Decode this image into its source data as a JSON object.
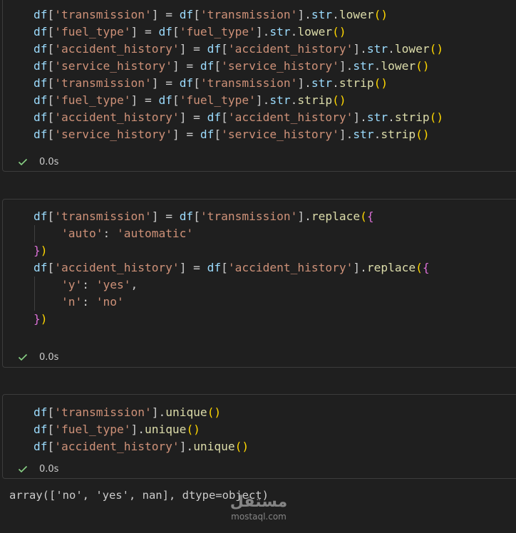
{
  "cells": [
    {
      "lines": [
        [
          [
            "v",
            "df"
          ],
          [
            "p",
            "["
          ],
          [
            "s",
            "'transmission'"
          ],
          [
            "p",
            "] = "
          ],
          [
            "v",
            "df"
          ],
          [
            "p",
            "["
          ],
          [
            "s",
            "'transmission'"
          ],
          [
            "p",
            "]."
          ],
          [
            "v",
            "str"
          ],
          [
            "p",
            "."
          ],
          [
            "f",
            "lower"
          ],
          [
            "b1",
            "()"
          ]
        ],
        [
          [
            "v",
            "df"
          ],
          [
            "p",
            "["
          ],
          [
            "s",
            "'fuel_type'"
          ],
          [
            "p",
            "] = "
          ],
          [
            "v",
            "df"
          ],
          [
            "p",
            "["
          ],
          [
            "s",
            "'fuel_type'"
          ],
          [
            "p",
            "]."
          ],
          [
            "v",
            "str"
          ],
          [
            "p",
            "."
          ],
          [
            "f",
            "lower"
          ],
          [
            "b1",
            "()"
          ]
        ],
        [
          [
            "v",
            "df"
          ],
          [
            "p",
            "["
          ],
          [
            "s",
            "'accident_history'"
          ],
          [
            "p",
            "] = "
          ],
          [
            "v",
            "df"
          ],
          [
            "p",
            "["
          ],
          [
            "s",
            "'accident_history'"
          ],
          [
            "p",
            "]."
          ],
          [
            "v",
            "str"
          ],
          [
            "p",
            "."
          ],
          [
            "f",
            "lower"
          ],
          [
            "b1",
            "()"
          ]
        ],
        [
          [
            "v",
            "df"
          ],
          [
            "p",
            "["
          ],
          [
            "s",
            "'service_history'"
          ],
          [
            "p",
            "] = "
          ],
          [
            "v",
            "df"
          ],
          [
            "p",
            "["
          ],
          [
            "s",
            "'service_history'"
          ],
          [
            "p",
            "]."
          ],
          [
            "v",
            "str"
          ],
          [
            "p",
            "."
          ],
          [
            "f",
            "lower"
          ],
          [
            "b1",
            "()"
          ]
        ],
        [
          [
            "v",
            "df"
          ],
          [
            "p",
            "["
          ],
          [
            "s",
            "'transmission'"
          ],
          [
            "p",
            "] = "
          ],
          [
            "v",
            "df"
          ],
          [
            "p",
            "["
          ],
          [
            "s",
            "'transmission'"
          ],
          [
            "p",
            "]."
          ],
          [
            "v",
            "str"
          ],
          [
            "p",
            "."
          ],
          [
            "f",
            "strip"
          ],
          [
            "b1",
            "()"
          ]
        ],
        [
          [
            "v",
            "df"
          ],
          [
            "p",
            "["
          ],
          [
            "s",
            "'fuel_type'"
          ],
          [
            "p",
            "] = "
          ],
          [
            "v",
            "df"
          ],
          [
            "p",
            "["
          ],
          [
            "s",
            "'fuel_type'"
          ],
          [
            "p",
            "]."
          ],
          [
            "v",
            "str"
          ],
          [
            "p",
            "."
          ],
          [
            "f",
            "strip"
          ],
          [
            "b1",
            "()"
          ]
        ],
        [
          [
            "v",
            "df"
          ],
          [
            "p",
            "["
          ],
          [
            "s",
            "'accident_history'"
          ],
          [
            "p",
            "] = "
          ],
          [
            "v",
            "df"
          ],
          [
            "p",
            "["
          ],
          [
            "s",
            "'accident_history'"
          ],
          [
            "p",
            "]."
          ],
          [
            "v",
            "str"
          ],
          [
            "p",
            "."
          ],
          [
            "f",
            "strip"
          ],
          [
            "b1",
            "()"
          ]
        ],
        [
          [
            "v",
            "df"
          ],
          [
            "p",
            "["
          ],
          [
            "s",
            "'service_history'"
          ],
          [
            "p",
            "] = "
          ],
          [
            "v",
            "df"
          ],
          [
            "p",
            "["
          ],
          [
            "s",
            "'service_history'"
          ],
          [
            "p",
            "]."
          ],
          [
            "v",
            "str"
          ],
          [
            "p",
            "."
          ],
          [
            "f",
            "strip"
          ],
          [
            "b1",
            "()"
          ]
        ]
      ],
      "status_time": "0.0s"
    },
    {
      "lines": [
        [
          [
            "v",
            "df"
          ],
          [
            "p",
            "["
          ],
          [
            "s",
            "'transmission'"
          ],
          [
            "p",
            "] = "
          ],
          [
            "v",
            "df"
          ],
          [
            "p",
            "["
          ],
          [
            "s",
            "'transmission'"
          ],
          [
            "p",
            "]."
          ],
          [
            "f",
            "replace"
          ],
          [
            "b1",
            "("
          ],
          [
            "b2",
            "{"
          ]
        ],
        [
          [
            "p",
            "    "
          ],
          [
            "s",
            "'auto'"
          ],
          [
            "p",
            ": "
          ],
          [
            "s",
            "'automatic'"
          ]
        ],
        [
          [
            "b2",
            "}"
          ],
          [
            "b1",
            ")"
          ]
        ],
        [
          [
            "v",
            "df"
          ],
          [
            "p",
            "["
          ],
          [
            "s",
            "'accident_history'"
          ],
          [
            "p",
            "] = "
          ],
          [
            "v",
            "df"
          ],
          [
            "p",
            "["
          ],
          [
            "s",
            "'accident_history'"
          ],
          [
            "p",
            "]."
          ],
          [
            "f",
            "replace"
          ],
          [
            "b1",
            "("
          ],
          [
            "b2",
            "{"
          ]
        ],
        [
          [
            "p",
            "    "
          ],
          [
            "s",
            "'y'"
          ],
          [
            "p",
            ": "
          ],
          [
            "s",
            "'yes'"
          ],
          [
            "p",
            ","
          ]
        ],
        [
          [
            "p",
            "    "
          ],
          [
            "s",
            "'n'"
          ],
          [
            "p",
            ": "
          ],
          [
            "s",
            "'no'"
          ]
        ],
        [
          [
            "b2",
            "}"
          ],
          [
            "b1",
            ")"
          ]
        ]
      ],
      "status_time": "0.0s"
    },
    {
      "lines": [
        [
          [
            "v",
            "df"
          ],
          [
            "p",
            "["
          ],
          [
            "s",
            "'transmission'"
          ],
          [
            "p",
            "]."
          ],
          [
            "f",
            "unique"
          ],
          [
            "b1",
            "()"
          ]
        ],
        [
          [
            "v",
            "df"
          ],
          [
            "p",
            "["
          ],
          [
            "s",
            "'fuel_type'"
          ],
          [
            "p",
            "]."
          ],
          [
            "f",
            "unique"
          ],
          [
            "b1",
            "()"
          ]
        ],
        [
          [
            "v",
            "df"
          ],
          [
            "p",
            "["
          ],
          [
            "s",
            "'accident_history'"
          ],
          [
            "p",
            "]."
          ],
          [
            "f",
            "unique"
          ],
          [
            "b1",
            "()"
          ]
        ]
      ],
      "status_time": "0.0s"
    }
  ],
  "output_text": "array(['no', 'yes', nan], dtype=object)",
  "watermark": {
    "main": "مستقل",
    "sub": "mostaql.com"
  },
  "colors": {
    "background": "#1f1f1f",
    "cell_border": "#3c3c3c",
    "variable": "#9cdcfe",
    "string": "#ce9178",
    "function": "#dcdcaa",
    "bracket_level1": "#ffd700",
    "bracket_level2": "#da70d6",
    "success_check": "#89d185"
  },
  "icons": {
    "status": "check-icon"
  }
}
